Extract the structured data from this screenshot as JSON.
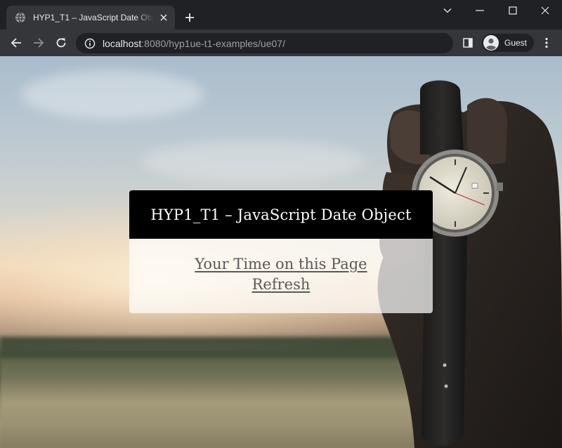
{
  "browser": {
    "tab": {
      "title": "HYP1_T1 – JavaScript Date Object"
    },
    "address_bar": {
      "host": "localhost",
      "path": ":8080/hyp1ue-t1-examples/ue07/"
    },
    "profile": {
      "label": "Guest"
    }
  },
  "page": {
    "card": {
      "heading": "HYP1_T1 – JavaScript Date Object",
      "link_line1": "Your Time on this Page",
      "link_line2": "Refresh"
    }
  },
  "colors": {
    "card_header_bg": "#000000",
    "card_link": "#595959",
    "tab_strip_bg": "#202124",
    "toolbar_bg": "#35363a"
  },
  "icons": [
    "globe-icon",
    "close-icon",
    "plus-icon",
    "chevron-down-icon",
    "minimize-icon",
    "maximize-icon",
    "back-icon",
    "forward-icon",
    "reload-icon",
    "info-icon",
    "side-panel-icon",
    "guest-avatar-icon",
    "more-icon"
  ]
}
